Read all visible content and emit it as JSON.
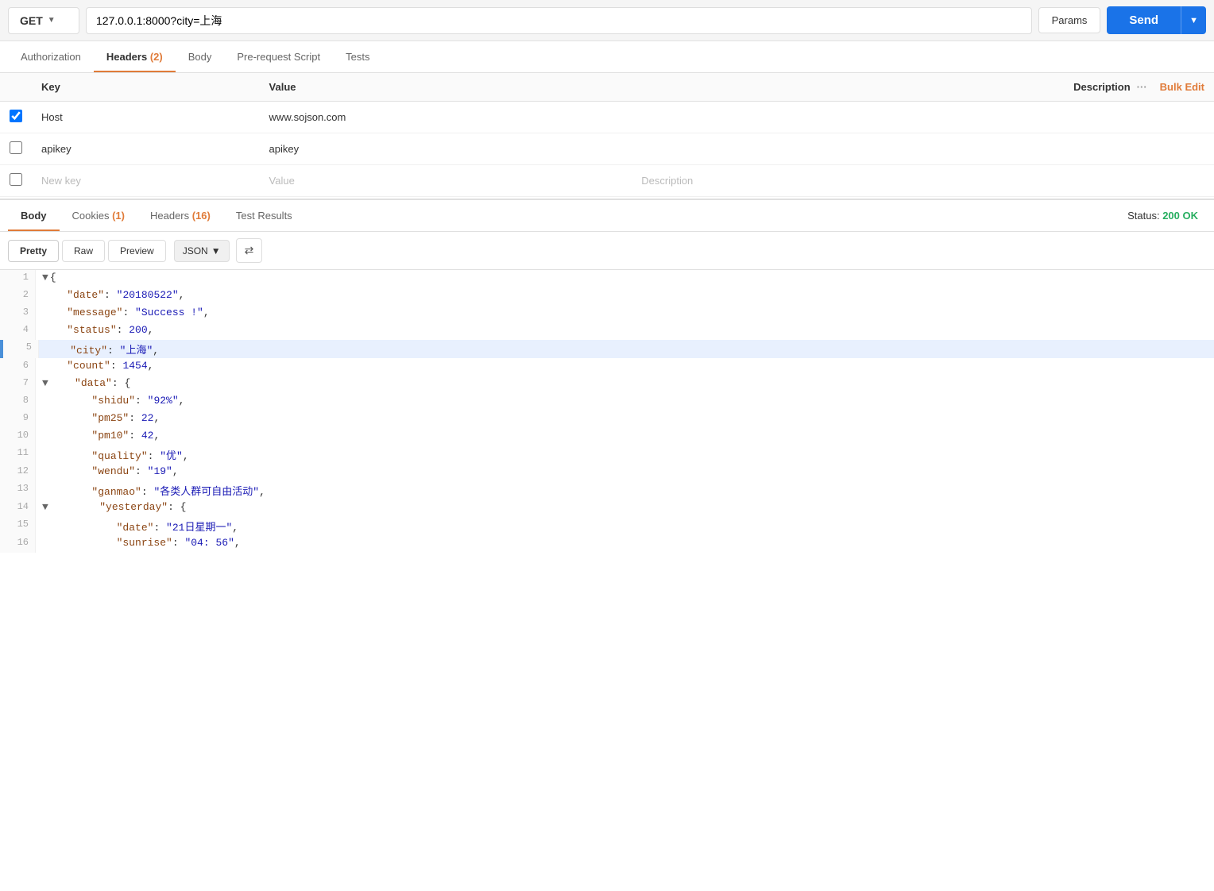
{
  "topbar": {
    "method": "GET",
    "url": "127.0.0.1:8000?city=上海",
    "params_label": "Params",
    "send_label": "Send"
  },
  "request_tabs": [
    {
      "id": "authorization",
      "label": "Authorization",
      "active": false,
      "badge": null
    },
    {
      "id": "headers",
      "label": "Headers",
      "active": true,
      "badge": "(2)"
    },
    {
      "id": "body",
      "label": "Body",
      "active": false,
      "badge": null
    },
    {
      "id": "prerequest",
      "label": "Pre-request Script",
      "active": false,
      "badge": null
    },
    {
      "id": "tests",
      "label": "Tests",
      "active": false,
      "badge": null
    }
  ],
  "headers_table": {
    "col_key": "Key",
    "col_value": "Value",
    "col_description": "Description",
    "bulk_edit": "Bulk Edit",
    "rows": [
      {
        "checked": true,
        "key": "Host",
        "value": "www.sojson.com",
        "description": ""
      },
      {
        "checked": false,
        "key": "apikey",
        "value": "apikey",
        "description": ""
      }
    ],
    "new_row": {
      "key_placeholder": "New key",
      "value_placeholder": "Value",
      "description_placeholder": "Description"
    }
  },
  "response_tabs": [
    {
      "id": "body",
      "label": "Body",
      "active": true,
      "badge": null
    },
    {
      "id": "cookies",
      "label": "Cookies",
      "active": false,
      "badge": "(1)"
    },
    {
      "id": "headers",
      "label": "Headers",
      "active": false,
      "badge": "(16)"
    },
    {
      "id": "test_results",
      "label": "Test Results",
      "active": false,
      "badge": null
    }
  ],
  "status": {
    "label": "Status:",
    "value": "200 OK"
  },
  "code_toolbar": {
    "pretty": "Pretty",
    "raw": "Raw",
    "preview": "Preview",
    "format": "JSON",
    "wrap_icon": "⇄"
  },
  "json_lines": [
    {
      "num": 1,
      "content": "{",
      "highlighted": false,
      "has_fold": true,
      "fold_open": true
    },
    {
      "num": 2,
      "content": "    \"date\": \"20180522\",",
      "highlighted": false
    },
    {
      "num": 3,
      "content": "    \"message\": \"Success !\",",
      "highlighted": false
    },
    {
      "num": 4,
      "content": "    \"status\": 200,",
      "highlighted": false
    },
    {
      "num": 5,
      "content": "    \"city\": \"上海\",",
      "highlighted": true
    },
    {
      "num": 6,
      "content": "    \"count\": 1454,",
      "highlighted": false
    },
    {
      "num": 7,
      "content": "    \"data\": {",
      "highlighted": false,
      "has_fold": true,
      "fold_open": true
    },
    {
      "num": 8,
      "content": "        \"shidu\": \"92%\",",
      "highlighted": false
    },
    {
      "num": 9,
      "content": "        \"pm25\": 22,",
      "highlighted": false
    },
    {
      "num": 10,
      "content": "        \"pm10\": 42,",
      "highlighted": false
    },
    {
      "num": 11,
      "content": "        \"quality\": \"优\",",
      "highlighted": false
    },
    {
      "num": 12,
      "content": "        \"wendu\": \"19\",",
      "highlighted": false
    },
    {
      "num": 13,
      "content": "        \"ganmao\": \"各类人群可自由活动\",",
      "highlighted": false
    },
    {
      "num": 14,
      "content": "        \"yesterday\": {",
      "highlighted": false,
      "has_fold": true,
      "fold_open": true
    },
    {
      "num": 15,
      "content": "            \"date\": \"21日星期一\",",
      "highlighted": false
    },
    {
      "num": 16,
      "content": "            \"sunrise\": \"04:56\",",
      "highlighted": false
    }
  ]
}
